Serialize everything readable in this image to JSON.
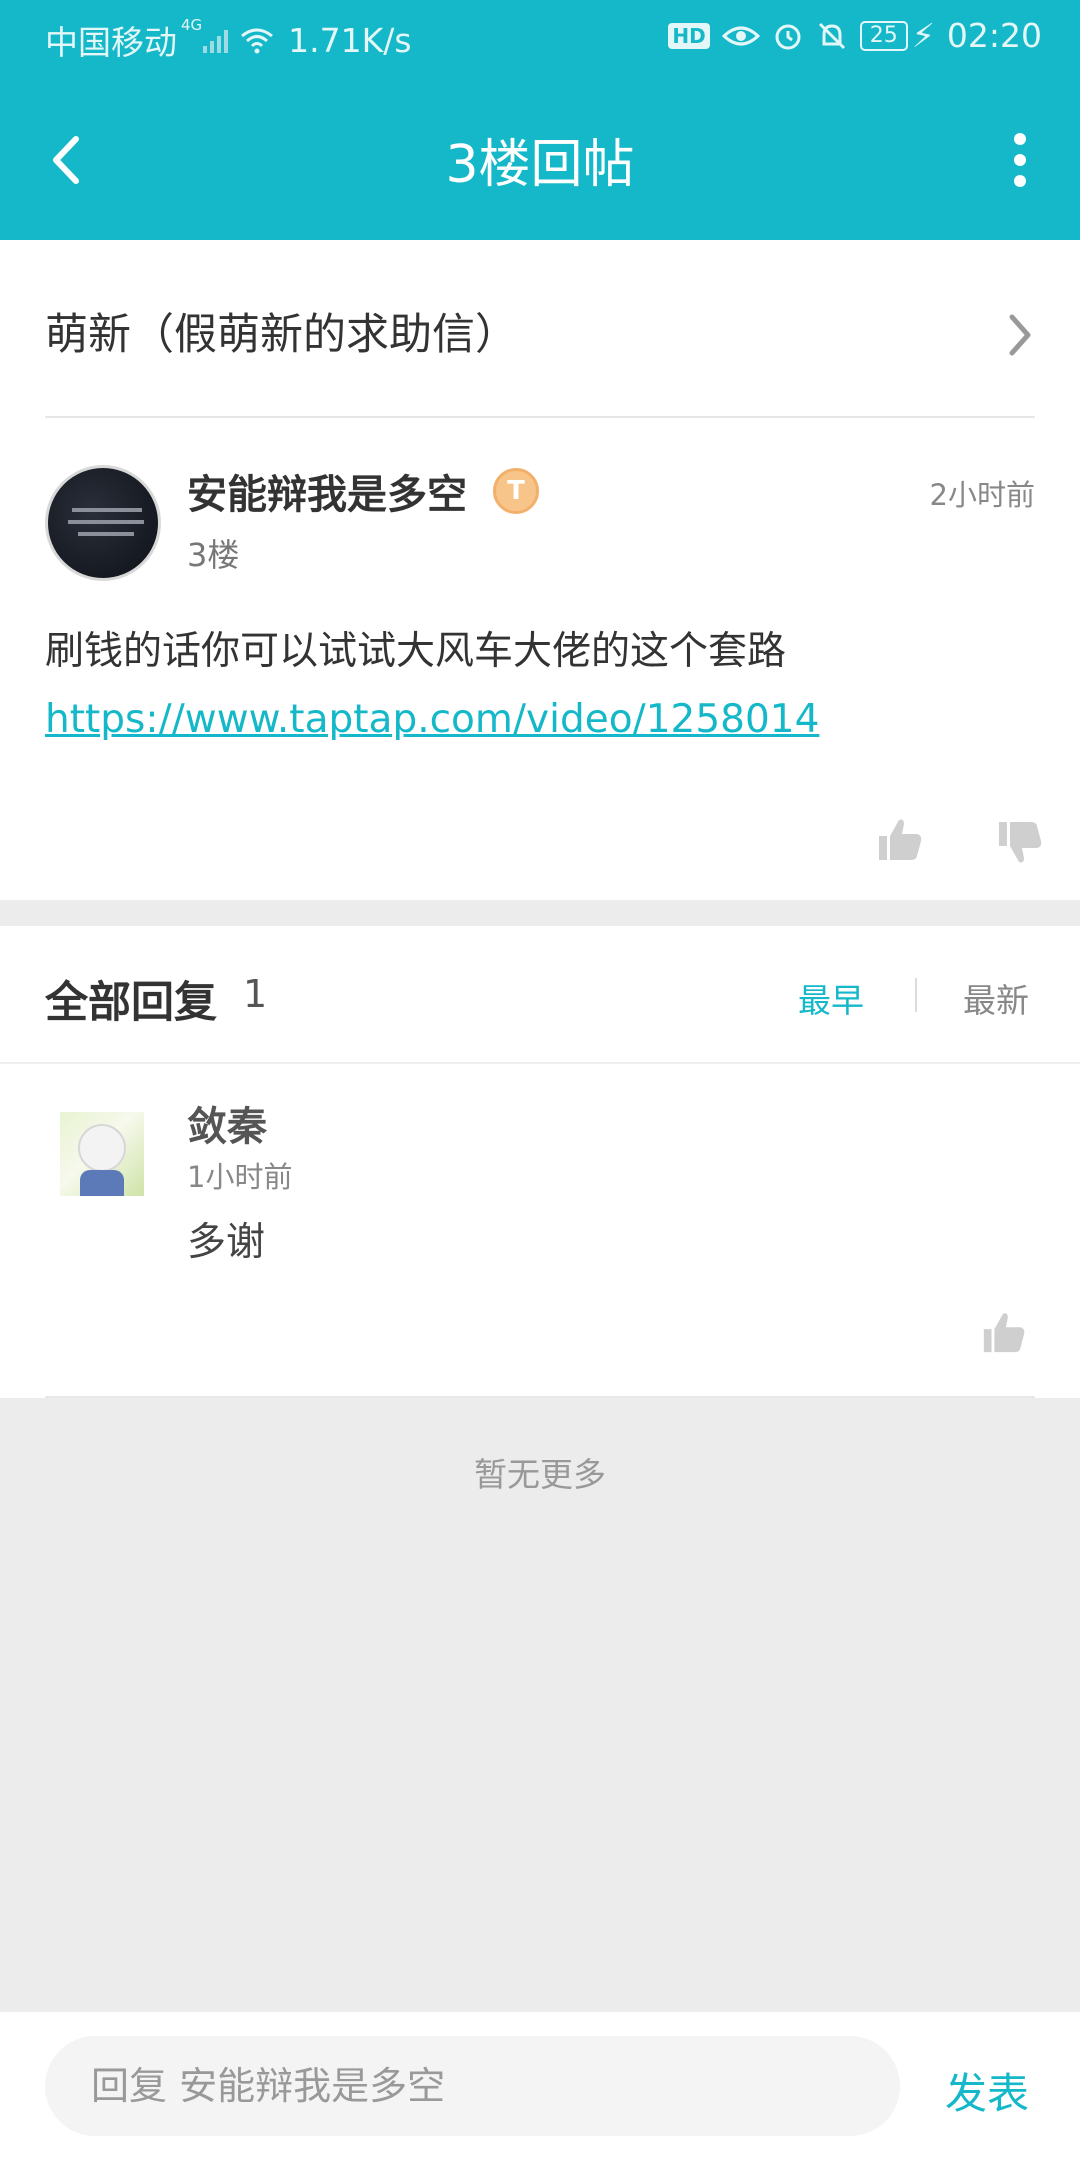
{
  "status_bar": {
    "carrier": "中国移动",
    "network": "4G",
    "speed": "1.71K/s",
    "hd": "HD",
    "battery": "25",
    "time": "02:20"
  },
  "nav": {
    "title": "3楼回帖"
  },
  "thread": {
    "title": "萌新（假萌新的求助信）"
  },
  "post": {
    "author": "安能辩我是多空",
    "badge": "T",
    "floor": "3楼",
    "time": "2小时前",
    "text": "刷钱的话你可以试试大风车大佬的这个套路",
    "link": "https://www.taptap.com/video/1258014"
  },
  "replies": {
    "title": "全部回复",
    "count": "1",
    "sort_earliest": "最早",
    "sort_newest": "最新",
    "items": [
      {
        "author": "敛秦",
        "time": "1小时前",
        "text": "多谢"
      }
    ]
  },
  "footer": {
    "no_more": "暂无更多",
    "input_placeholder": "回复 安能辩我是多空",
    "submit": "发表"
  },
  "colors": {
    "accent": "#15b8c8",
    "badge": "#f7c489"
  }
}
